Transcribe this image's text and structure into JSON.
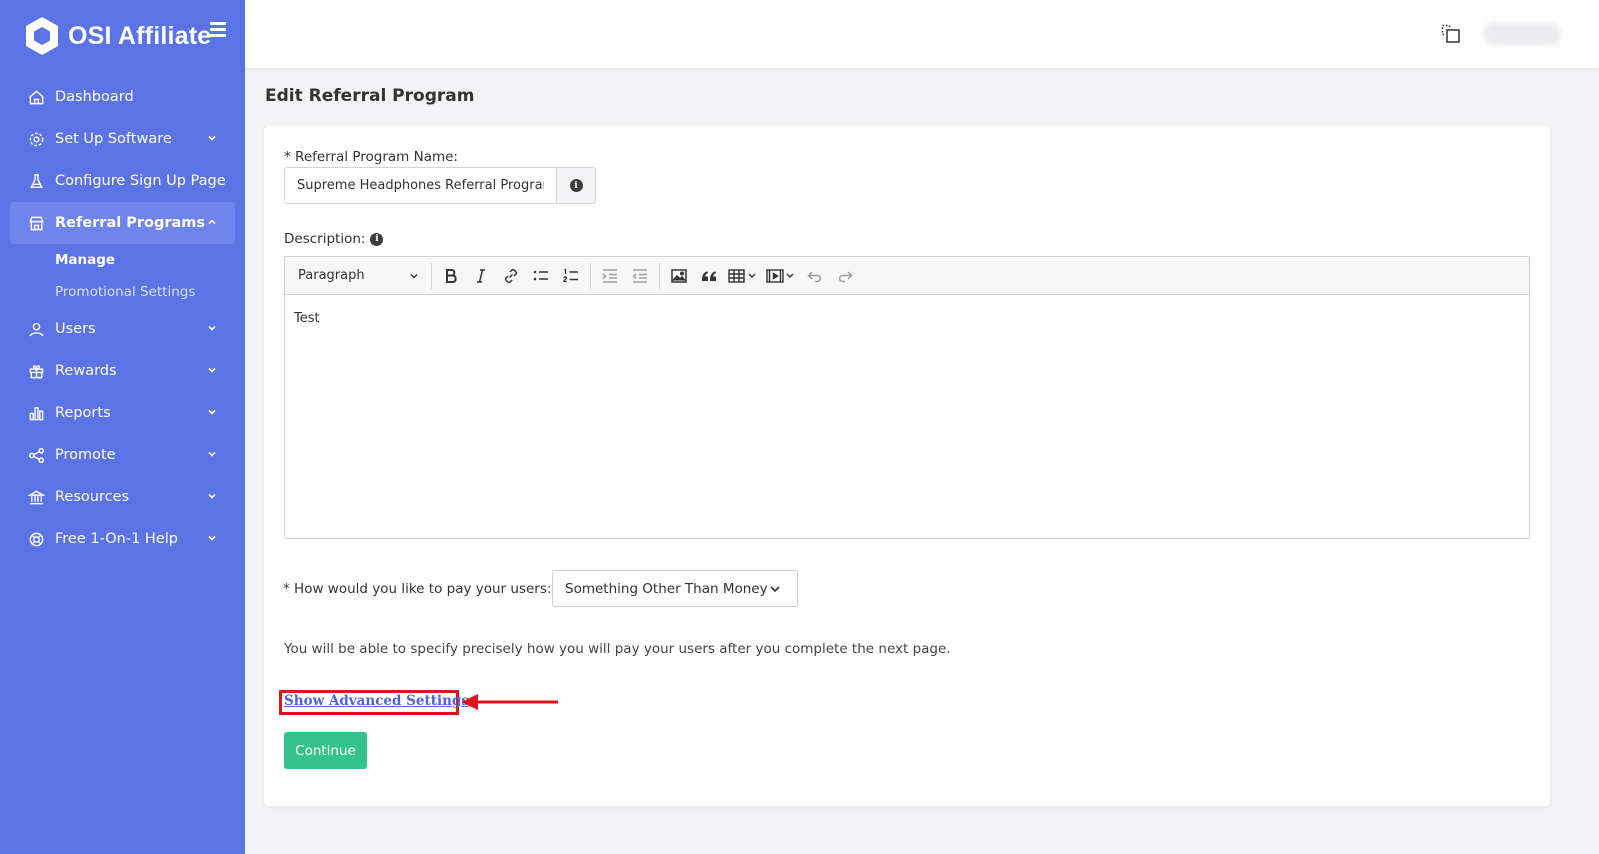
{
  "brand": {
    "name": "OSI Affiliate"
  },
  "sidebar": {
    "items": [
      {
        "label": "Dashboard",
        "icon": "home-icon"
      },
      {
        "label": "Set Up Software",
        "icon": "gear-icon"
      },
      {
        "label": "Configure Sign Up Page",
        "icon": "flask-icon"
      },
      {
        "label": "Referral Programs",
        "icon": "store-icon"
      },
      {
        "label": "Users",
        "icon": "user-icon"
      },
      {
        "label": "Rewards",
        "icon": "gift-icon"
      },
      {
        "label": "Reports",
        "icon": "bar-chart-icon"
      },
      {
        "label": "Promote",
        "icon": "share-icon"
      },
      {
        "label": "Resources",
        "icon": "bank-icon"
      },
      {
        "label": "Free 1-On-1 Help",
        "icon": "lifebuoy-icon"
      }
    ],
    "sub_items": [
      {
        "label": "Manage"
      },
      {
        "label": "Promotional Settings"
      }
    ]
  },
  "page": {
    "title": "Edit Referral Program"
  },
  "form": {
    "name_label": "* Referral Program Name:",
    "name_value": "Supreme Headphones Referral Program",
    "description_label": "Description:",
    "editor": {
      "block_format": "Paragraph",
      "content": "Test"
    },
    "pay_label": "* How would you like to pay your users:",
    "pay_value": "Something Other Than Money",
    "note": "You will be able to specify precisely how you will pay your users after you complete the next page.",
    "advanced_link": "Show Advanced Settings",
    "continue_label": "Continue"
  },
  "colors": {
    "sidebar": "#5c73e6",
    "sidebar_active": "#6f84ec",
    "continue": "#34c38f",
    "annotation_red": "#e0141e",
    "link": "#5063d8"
  }
}
